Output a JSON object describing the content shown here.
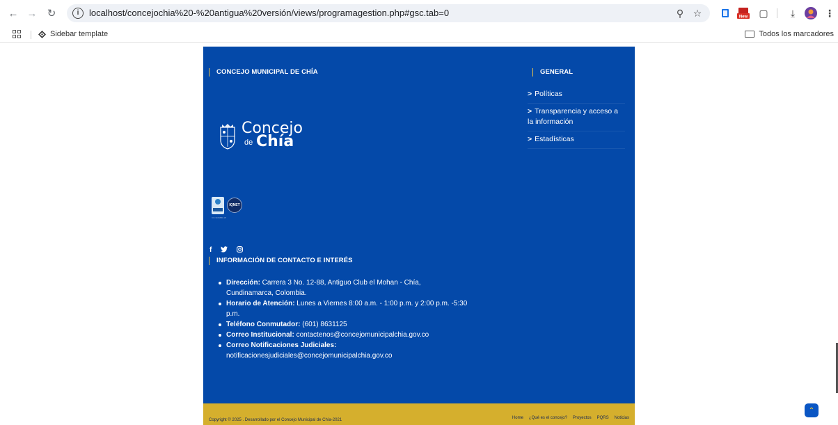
{
  "browser": {
    "url": "localhost/concejochia%20-%20antigua%20versión/views/programagestion.php#gsc.tab=0",
    "bookmarks": {
      "item_label": "Sidebar template",
      "all_bookmarks_label": "Todos los marcadores"
    },
    "icons": [
      "back-arrow-icon",
      "forward-arrow-icon",
      "reload-icon",
      "info-icon",
      "zoom-icon",
      "star-icon",
      "extension-icon",
      "new-badge-icon",
      "puzzle-icon",
      "download-icon",
      "profile-avatar-icon",
      "more-icon"
    ]
  },
  "footer": {
    "left_title": "CONCEJO MUNICIPAL DE CHÍA",
    "logo": {
      "line1": "Concejo",
      "de": "de",
      "line2": "Chía"
    },
    "certs": {
      "iqnet": "IQNET",
      "caption": "CO-SC6880-18"
    },
    "social": [
      "f",
      "y",
      "o"
    ],
    "contact_title": "INFORMACIÓN DE CONTACTO E INTERÉS",
    "contact": [
      {
        "label": "Dirección:",
        "value": " Carrera 3 No. 12-88, Antiguo Club el Mohan - Chía, Cundinamarca, Colombia."
      },
      {
        "label": "Horario de Atención:",
        "value": " Lunes a Viernes 8:00 a.m. - 1:00 p.m. y 2:00 p.m. -5:30 p.m."
      },
      {
        "label": "Teléfono Conmutador:",
        "value": " (601) 8631125"
      },
      {
        "label": "Correo Institucional:",
        "value": " contactenos@concejomunicipalchia.gov.co"
      },
      {
        "label": "Correo Notificaciones Judiciales:",
        "value": " notificacionesjudiciales@concejomunicipalchia.gov.co"
      }
    ],
    "general_title": "GENERAL",
    "general_links": [
      {
        "label": "Políticas"
      },
      {
        "label": "Transparencia y acceso a la información"
      },
      {
        "label": "Estadísticas"
      }
    ],
    "chevron": ">",
    "copyright": "Copyright © 2025 . Desarrollado por el Concejo Municipal de Chía-2021",
    "bottom_links": [
      "Home",
      "¿Qué es el concejo?",
      "Proyectos",
      "PQRS",
      "Noticias"
    ]
  },
  "colors": {
    "footer_blue": "#0449a9",
    "footer_gold": "#d5af2d",
    "accent_yellow": "#e8c04a"
  }
}
